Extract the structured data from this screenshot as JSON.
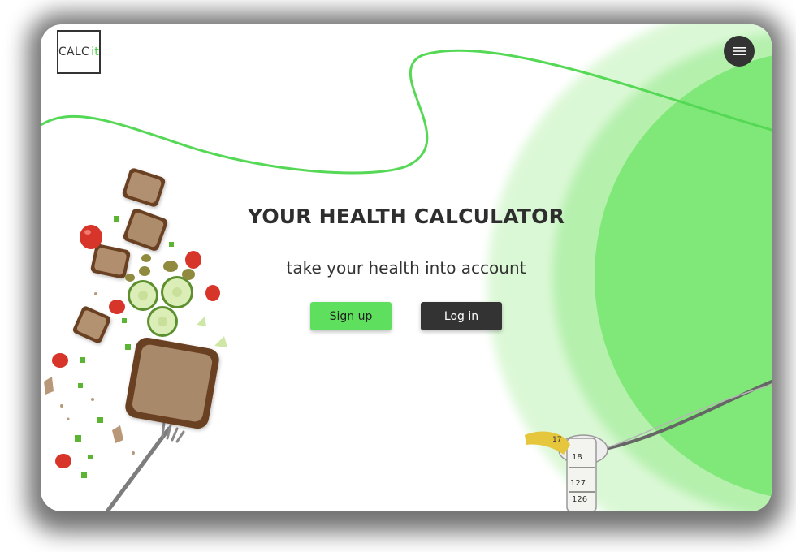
{
  "logo": {
    "text": "CALC",
    "accent": "it"
  },
  "menu": {
    "icon": "hamburger-icon"
  },
  "hero": {
    "title": "YOUR HEALTH CALCULATOR",
    "subtitle": "take your health into account"
  },
  "buttons": {
    "signup_label": "Sign up",
    "login_label": "Log in"
  },
  "tape_numbers": [
    "18",
    "127",
    "126",
    "17"
  ],
  "colors": {
    "accent": "#5ee05e",
    "dark": "#333333",
    "circle": "#7fe87a",
    "glow": "#d8f8d4",
    "line": "#55d855"
  }
}
